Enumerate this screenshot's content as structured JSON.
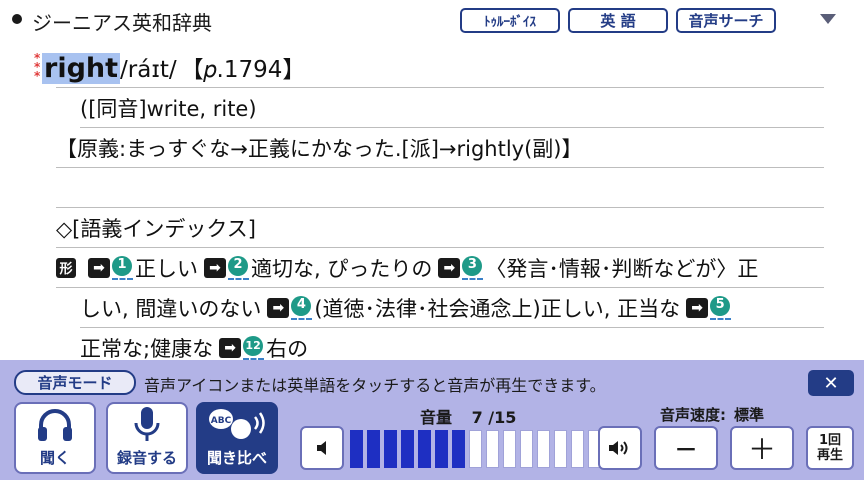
{
  "header": {
    "dictionary_title": "ジーニアス英和辞典",
    "buttons": [
      "ﾄｩﾙｰﾎﾞｲｽ",
      "英 語",
      "音声サーチ"
    ]
  },
  "entry": {
    "headword": "right",
    "pronunciation": "/ráɪt/",
    "page_ref": "【𝑝.1794】",
    "homophones": "([同音]write, rite)",
    "etymology": "【原義:まっすぐな→正義にかなった.[派]→rightly(副)】",
    "index_heading": "◇[語義インデックス]",
    "pos_label": "形",
    "senses": [
      {
        "num": "1",
        "text": "正しい"
      },
      {
        "num": "2",
        "text": "適切な, ぴったりの"
      },
      {
        "num": "3",
        "text": "〈発言･情報･判断などが〉正"
      },
      {
        "text_cont": "しい, 間違いのない"
      },
      {
        "num": "4",
        "text": "(道徳･法律･社会通念上)正しい, 正当な"
      },
      {
        "num": "5",
        "text": ""
      },
      {
        "text_cont2": "正常な;健康な"
      },
      {
        "num": "12",
        "text": "右の"
      }
    ]
  },
  "voice_panel": {
    "mode_label": "音声モード",
    "hint": "音声アイコンまたは英単語をタッチすると音声が再生できます。",
    "close_label": "✕",
    "listen_label": "聞く",
    "record_label": "録音する",
    "compare_label": "聞き比べ",
    "compare_badge": "ABC",
    "volume_label": "音量",
    "volume_value": "7 /15",
    "volume_level": 7,
    "volume_max": 15,
    "speed_label": "音声速度:",
    "speed_value": "標準",
    "minus_label": "−",
    "plus_label": "＋",
    "once_line1": "1回",
    "once_line2": "再生"
  }
}
